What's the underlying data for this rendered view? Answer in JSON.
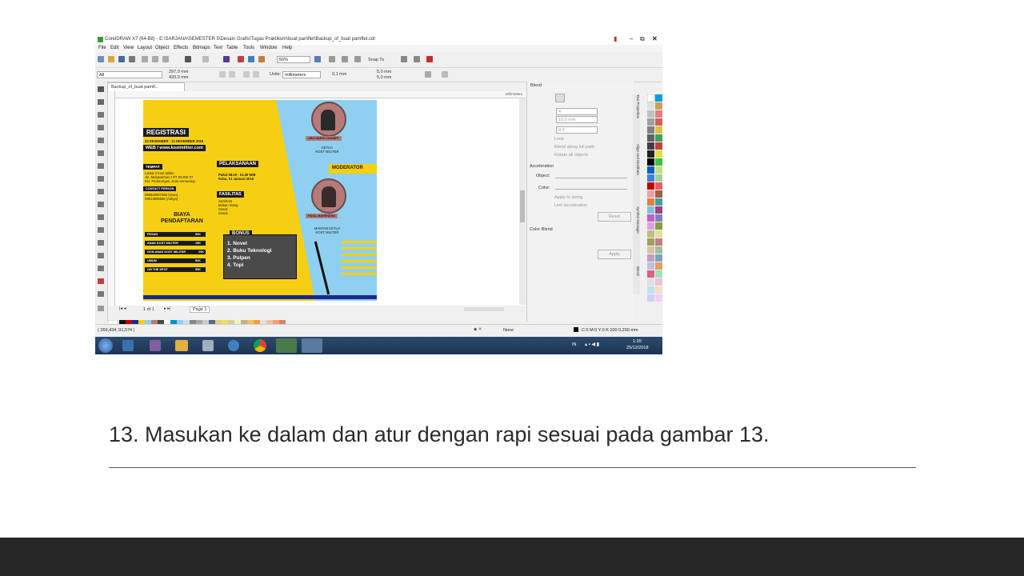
{
  "window": {
    "title": "CorelDRAW X7 (64-Bit) - E:\\SARJANA\\SEMESTER 5\\Desain Grafis\\Tugas Praktikum\\buat pamflet\\Backup_of_buat pamflet.cdr",
    "menu": [
      "File",
      "Edit",
      "View",
      "Layout",
      "Object",
      "Effects",
      "Bitmaps",
      "Text",
      "Table",
      "Tools",
      "Window",
      "Help"
    ],
    "zoom": "50%",
    "snap_to": "Snap To",
    "object_select": "All",
    "width_value": "297,0 mm",
    "height_value": "420,0 mm",
    "units_label": "Units:",
    "units_value": "millimeters",
    "nudge": "0,1 mm",
    "dup_x": "5,0 mm",
    "dup_y": "5,0 mm",
    "doc_tab": "Backup_of_buat pamfl...",
    "ruler_units": "millimeters",
    "page_nav": "1 of 1",
    "page_tab": "Page 1",
    "status_coords": "( 269,434; 91,574 )",
    "status_fill": "None",
    "status_outline": "C:0 M:0 Y:0 K:100  0,200 mm",
    "taskbar_lang": "IN",
    "taskbar_time": "1:20",
    "taskbar_date": "25/12/2018"
  },
  "docker": {
    "title": "Blend",
    "steps": "4",
    "spacing": "10,0 mm",
    "angle": "0,0",
    "loop": "Loop",
    "blend_full_path": "Blend along full path",
    "rotate_all": "Rotate all objects",
    "acceleration": "Acceleration",
    "object": "Object:",
    "color": "Color:",
    "apply_sizing": "Apply to sizing",
    "link_accel": "Link acceleration",
    "reset": "Reset",
    "color_blend": "Color Blend",
    "apply": "Apply",
    "side_tabs": [
      "Text Properties",
      "Align and Distribute",
      "Symbol Manager",
      "Blend"
    ]
  },
  "flyer": {
    "registrasi": "REGISTRASI",
    "reg_dates": "24 DESEMBER - 31 DESEMBER 2018",
    "web": "WEB / www.kostmiliter.com",
    "tempat": "TEMPAT",
    "tempat_text": "Lantai 2 Kost Militer\nJln. Mulawarman I RT 05 RW 07\nKel. Pedurungan, Kota Semarang",
    "contact": "CONTACT PERSON",
    "contact_text": "085840007288 (Iman)\n08813806658 (Aditya)",
    "pelaksanaan": "PELAKSANAAN",
    "pelaksanaan_text": "Pukul 08.00 - 01.00 WIB\nRabu, 01 Januari 2019",
    "fasilitas": "FASILITAS",
    "fasilitas_text": "SertiKost\nMakan Siang\nSnack\nSnack",
    "biaya": "BIAYA\nPENDAFTARAN",
    "fees": [
      {
        "label": "PESAN",
        "val": "50K"
      },
      {
        "label": "ANAK KOST MILITER",
        "val": "15K"
      },
      {
        "label": "NON ANAK KOST MILITER",
        "val": "20K"
      },
      {
        "label": "UMUM",
        "val": "50K"
      },
      {
        "label": "ON THE SPOT",
        "val": "55K"
      }
    ],
    "bonus": "BONUS",
    "bonus_items": "1. Novel\n2. Buku Teknologi\n3. Pulpen\n4. Topi",
    "person1_name": "ABU HARIS KHANIFF",
    "person1_role": "KETUA\nKOST MILITER",
    "moderator": "MODERATOR",
    "person2_name": "RIZAL MAHENDRA",
    "person2_role": "MANTAN KETUA\nKOST MILITER"
  },
  "slide": {
    "caption": "13. Masukan ke dalam dan atur dengan rapi sesuai pada gambar 13."
  },
  "colors": {
    "yellow": "#f6cf12",
    "sky": "#8fd0f0",
    "footer": "#262626"
  }
}
